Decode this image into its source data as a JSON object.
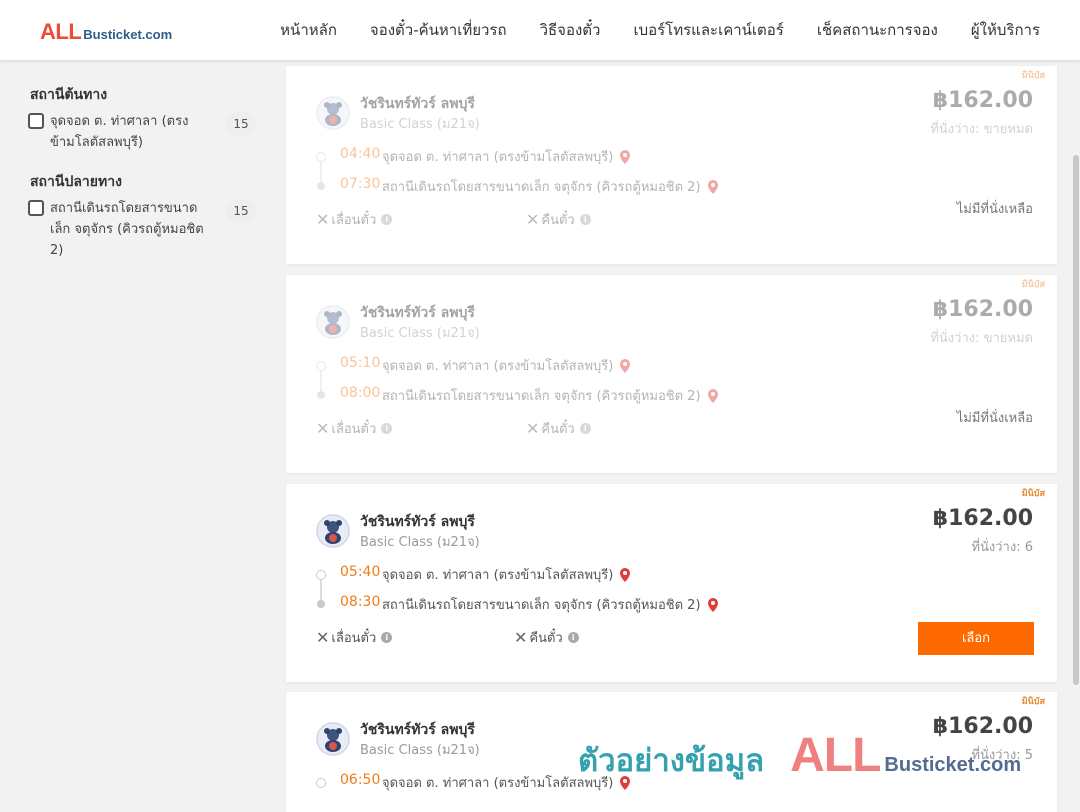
{
  "header": {
    "logo_all": "ALL",
    "logo_bt": "Busticket.com",
    "nav": [
      "หน้าหลัก",
      "จองตั๋ว-ค้นหาเที่ยวรถ",
      "วิธีจองตั๋ว",
      "เบอร์โทรและเคาน์เตอร์",
      "เช็คสถานะการจอง",
      "ผู้ให้บริการ"
    ]
  },
  "sidebar": {
    "origin_title": "สถานีต้นทาง",
    "origin_label": "จุดจอด ต. ท่าศาลา (ตรงข้ามโลตัสลพบุรี)",
    "origin_count": "15",
    "dest_title": "สถานีปลายทาง",
    "dest_label": "สถานีเดินรถโดยสารขนาดเล็ก จตุจักร (คิวรถตู้หมอชิต 2)",
    "dest_count": "15"
  },
  "trips": [
    {
      "operator": "วัชรินทร์ทัวร์ ลพบุรี",
      "bus_class": "Basic Class (ม21จ)",
      "tag": "มินิบัส",
      "price": "฿162.00",
      "seats": "ที่นั่งว่าง: ขายหมด",
      "depart_time": "04:40",
      "depart_stop": "จุดจอด ต. ท่าศาลา (ตรงข้ามโลตัสลพบุรี)",
      "arrive_time": "07:30",
      "arrive_stop": "สถานีเดินรถโดยสารขนาดเล็ก จตุจักร (คิวรถตู้หมอชิต 2)",
      "postpone": "เลื่อนตั๋ว",
      "refund": "คืนตั๋ว",
      "status": "ไม่มีที่นั่งเหลือ"
    },
    {
      "operator": "วัชรินทร์ทัวร์ ลพบุรี",
      "bus_class": "Basic Class (ม21จ)",
      "tag": "มินิบัส",
      "price": "฿162.00",
      "seats": "ที่นั่งว่าง: ขายหมด",
      "depart_time": "05:10",
      "depart_stop": "จุดจอด ต. ท่าศาลา (ตรงข้ามโลตัสลพบุรี)",
      "arrive_time": "08:00",
      "arrive_stop": "สถานีเดินรถโดยสารขนาดเล็ก จตุจักร (คิวรถตู้หมอชิต 2)",
      "postpone": "เลื่อนตั๋ว",
      "refund": "คืนตั๋ว",
      "status": "ไม่มีที่นั่งเหลือ"
    },
    {
      "operator": "วัชรินทร์ทัวร์ ลพบุรี",
      "bus_class": "Basic Class (ม21จ)",
      "tag": "มินิบัส",
      "price": "฿162.00",
      "seats": "ที่นั่งว่าง: 6",
      "depart_time": "05:40",
      "depart_stop": "จุดจอด ต. ท่าศาลา (ตรงข้ามโลตัสลพบุรี)",
      "arrive_time": "08:30",
      "arrive_stop": "สถานีเดินรถโดยสารขนาดเล็ก จตุจักร (คิวรถตู้หมอชิต 2)",
      "postpone": "เลื่อนตั๋ว",
      "refund": "คืนตั๋ว",
      "select_label": "เลือก"
    },
    {
      "operator": "วัชรินทร์ทัวร์ ลพบุรี",
      "bus_class": "Basic Class (ม21จ)",
      "tag": "มินิบัส",
      "price": "฿162.00",
      "seats": "ที่นั่งว่าง: 5",
      "depart_time": "06:50",
      "depart_stop": "จุดจอด ต. ท่าศาลา (ตรงข้ามโลตัสลพบุรี)"
    }
  ],
  "watermark": {
    "thai": "ตัวอย่างข้อมูล",
    "all": "ALL",
    "bt": "Busticket.com"
  },
  "colors": {
    "accent": "#ff6a00",
    "time": "#f07d1a",
    "pin": "#e23b3b",
    "logo_red": "#ef4a3a",
    "logo_blue": "#2e5d8a"
  },
  "icons": {
    "location": "map-pin-icon",
    "cancel": "x-icon",
    "info": "info-icon"
  }
}
